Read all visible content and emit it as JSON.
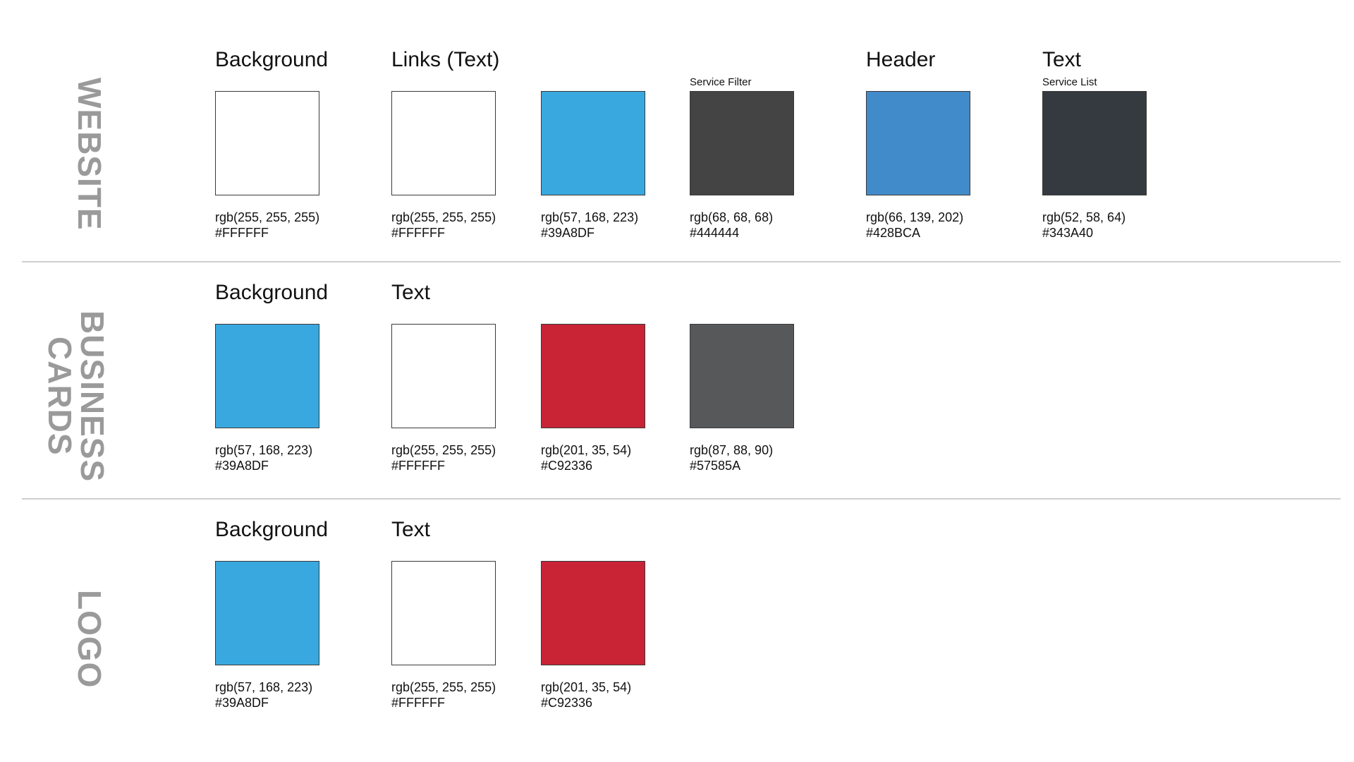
{
  "sections": [
    {
      "title": "WEBSITE",
      "headings": [
        "Background",
        "Links (Text)",
        "Header",
        "Text"
      ],
      "subheadings": [
        "Service Filter",
        "Service List"
      ],
      "swatches": [
        {
          "rgb": "rgb(255, 255, 255)",
          "hex": "#FFFFFF",
          "color": "#FFFFFF"
        },
        {
          "rgb": "rgb(255, 255, 255)",
          "hex": "#FFFFFF",
          "color": "#FFFFFF"
        },
        {
          "rgb": "rgb(57, 168, 223)",
          "hex": "#39A8DF",
          "color": "#39A8DF"
        },
        {
          "rgb": "rgb(68, 68, 68)",
          "hex": "#444444",
          "color": "#444444"
        },
        {
          "rgb": "rgb(66, 139, 202)",
          "hex": "#428BCA",
          "color": "#428BCA"
        },
        {
          "rgb": "rgb(52, 58, 64)",
          "hex": "#343A40",
          "color": "#343A40"
        }
      ]
    },
    {
      "title": "BUSINESS\nCARDS",
      "headings": [
        "Background",
        "Text"
      ],
      "subheadings": [],
      "swatches": [
        {
          "rgb": "rgb(57, 168, 223)",
          "hex": "#39A8DF",
          "color": "#39A8DF"
        },
        {
          "rgb": "rgb(255, 255, 255)",
          "hex": "#FFFFFF",
          "color": "#FFFFFF"
        },
        {
          "rgb": "rgb(201, 35, 54)",
          "hex": "#C92336",
          "color": "#C92336"
        },
        {
          "rgb": "rgb(87, 88, 90)",
          "hex": "#57585A",
          "color": "#57585A"
        }
      ]
    },
    {
      "title": "LOGO",
      "headings": [
        "Background",
        "Text"
      ],
      "subheadings": [],
      "swatches": [
        {
          "rgb": "rgb(57, 168, 223)",
          "hex": "#39A8DF",
          "color": "#39A8DF"
        },
        {
          "rgb": "rgb(255, 255, 255)",
          "hex": "#FFFFFF",
          "color": "#FFFFFF"
        },
        {
          "rgb": "rgb(201, 35, 54)",
          "hex": "#C92336",
          "color": "#C92336"
        }
      ]
    }
  ]
}
